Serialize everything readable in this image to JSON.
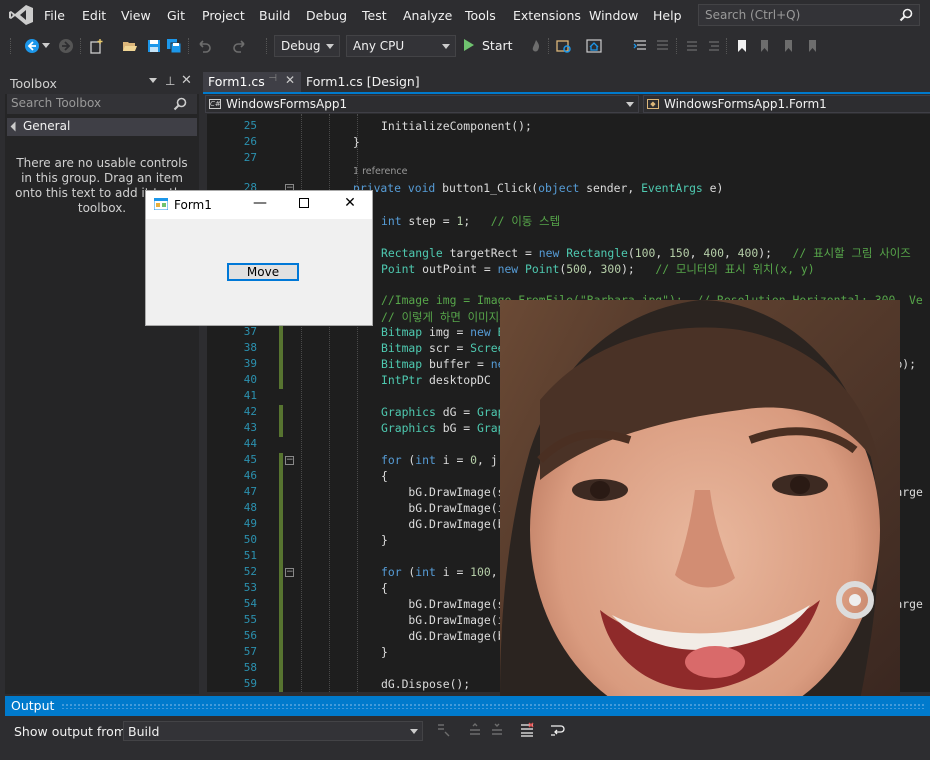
{
  "menu": [
    "File",
    "Edit",
    "View",
    "Git",
    "Project",
    "Build",
    "Debug",
    "Test",
    "Analyze",
    "Tools",
    "Extensions",
    "Window",
    "Help"
  ],
  "search": {
    "placeholder": "Search (Ctrl+Q)"
  },
  "toolbar": {
    "config": "Debug",
    "platform": "Any CPU",
    "start": "Start"
  },
  "toolbox": {
    "title": "Toolbox",
    "search_placeholder": "Search Toolbox",
    "group": "General",
    "empty_message": "There are no usable controls in this group. Drag an item onto this text to add it to the toolbox."
  },
  "tabs": [
    {
      "label": "Form1.cs",
      "active": true
    },
    {
      "label": "Form1.cs [Design]",
      "active": false
    }
  ],
  "nav": {
    "project": "WindowsFormsApp1",
    "class": "WindowsFormsApp1.Form1"
  },
  "editor": {
    "references_label": "1 reference",
    "lines": [
      {
        "n": "25",
        "html": "InitializeComponent();"
      },
      {
        "n": "26",
        "html": "}"
      },
      {
        "n": "27",
        "html": ""
      },
      {
        "n": "28",
        "html": "<span class=\"kw\">private void</span> button1_Click(<span class=\"kw\">object</span> sender, <span class=\"ty\">EventArgs</span> e)"
      },
      {
        "n": "29",
        "html": "{"
      },
      {
        "n": "30",
        "html": "<span class=\"kw\">int</span> step = <span class=\"nm\">1</span>;   <span class=\"cm\">// 이동 스텝</span>"
      },
      {
        "n": "31",
        "html": ""
      },
      {
        "n": "32",
        "html": "<span class=\"ty\">Rectangle</span> targetRect = <span class=\"kw\">new</span> <span class=\"ty\">Rectangle</span>(<span class=\"nm\">100</span>, <span class=\"nm\">150</span>, <span class=\"nm\">400</span>, <span class=\"nm\">400</span>);   <span class=\"cm\">// 표시할 그림 사이즈</span>"
      },
      {
        "n": "33",
        "html": "<span class=\"ty\">Point</span> outPoint = <span class=\"kw\">new</span> <span class=\"ty\">Point</span>(<span class=\"nm\">500</span>, <span class=\"nm\">300</span>);   <span class=\"cm\">// 모니터의 표시 위치(x, y)</span>"
      },
      {
        "n": "34",
        "html": ""
      },
      {
        "n": "35",
        "html": "<span class=\"cm\">//Image img = Image.FromFile(\"Barbara.jpg\");  // Resolution Horizontal: 300, Ve</span>"
      },
      {
        "n": "36",
        "html": "<span class=\"cm\">// 이렇게 하면 이미지의 DPI에 따라 그려지는 이미지 사이즈가</span>"
      },
      {
        "n": "37",
        "html": "<span class=\"ty\">Bitmap</span> img = <span class=\"kw\">new</span> <span class=\"ty\">Bitmap</span>(<span class=\"st\">\"Barbara.jpg\"</span>);  <span class=\"cm\">// Resolution Horizontal</span>"
      },
      {
        "n": "38",
        "html": "<span class=\"ty\">Bitmap</span> scr = <span class=\"ty\">Screen</span>.PrimaryScreen.Bounds;"
      },
      {
        "n": "39",
        "html": "<span class=\"ty\">Bitmap</span> buffer = <span class=\"kw\">new</span> <span class=\"ty\">Bitmap</span>(targetRect.Width + step, targetRect.Height + step);"
      },
      {
        "n": "40",
        "html": "<span class=\"ty\">IntPtr</span> desktopDC"
      },
      {
        "n": "41",
        "html": ""
      },
      {
        "n": "42",
        "html": "<span class=\"ty\">Graphics</span> dG = <span class=\"ty\">Graphics</span>.FromHdc(desktopDC);"
      },
      {
        "n": "43",
        "html": "<span class=\"ty\">Graphics</span> bG = <span class=\"ty\">Graphics</span>.FromImage(buffer);"
      },
      {
        "n": "44",
        "html": ""
      },
      {
        "n": "45",
        "html": "<span class=\"kw\">for</span> (<span class=\"kw\">int</span> i = <span class=\"nm\">0</span>, j"
      },
      {
        "n": "46",
        "html": "{"
      },
      {
        "n": "47",
        "html": "    bG.DrawImage(scr, <span class=\"nm\">0</span>, <span class=\"nm\">0</span>, <span class=\"kw\">new</span> <span class=\"ty\">Rectangle</span>(outPoint.X + i, outPoint.Y + j, targe"
      },
      {
        "n": "48",
        "html": "    bG.DrawImage(img, i, j, targetRect, <span class=\"ty\">GraphicsUnit</span>.Pixel);"
      },
      {
        "n": "49",
        "html": "    dG.DrawImage(buffer, outPoint.X, outPoint.Y);"
      },
      {
        "n": "50",
        "html": "}"
      },
      {
        "n": "51",
        "html": ""
      },
      {
        "n": "52",
        "html": "<span class=\"kw\">for</span> (<span class=\"kw\">int</span> i = <span class=\"nm\">100</span>,"
      },
      {
        "n": "53",
        "html": "{"
      },
      {
        "n": "54",
        "html": "    bG.DrawImage(scr, <span class=\"nm\">0</span>, <span class=\"nm\">0</span>, <span class=\"kw\">new</span> <span class=\"ty\">Rectangle</span>(outPoint.X + i, outPoint.Y + j, targe"
      },
      {
        "n": "55",
        "html": "    bG.DrawImage(img, i, j, targetRect, <span class=\"ty\">GraphicsUnit</span>.Pixel);"
      },
      {
        "n": "56",
        "html": "    dG.DrawImage(buffer, outPoint.X, outPoint.Y);"
      },
      {
        "n": "57",
        "html": "}"
      },
      {
        "n": "58",
        "html": ""
      },
      {
        "n": "59",
        "html": "dG.Dispose();"
      }
    ]
  },
  "form1": {
    "title": "Form1",
    "button": "Move"
  },
  "output": {
    "title": "Output",
    "show_from_label": "Show output from:",
    "source": "Build"
  },
  "colors": {
    "accent": "#007acc",
    "background": "#2d2d30",
    "editor": "#1e1e1e"
  }
}
